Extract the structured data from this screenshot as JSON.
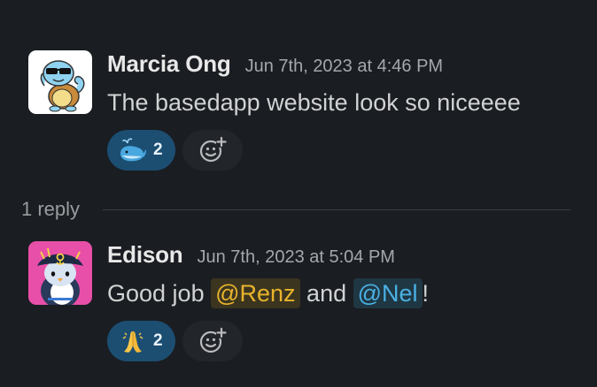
{
  "messages": [
    {
      "author": "Marcia Ong",
      "timestamp": "Jun 7th, 2023 at 4:46 PM",
      "text": "The basedapp website look so niceeee",
      "avatar_icon": "squirtle-sunglasses-icon",
      "reactions": [
        {
          "emoji_name": "whale-icon",
          "count": "2"
        }
      ]
    },
    {
      "author": "Edison",
      "timestamp": "Jun 7th, 2023 at 5:04 PM",
      "text_parts": {
        "before": "Good job ",
        "mention1": "@Renz",
        "middle": " and ",
        "mention2": "@Nel",
        "after": "!"
      },
      "avatar_icon": "pirate-penguin-icon",
      "reactions": [
        {
          "emoji_name": "folded-hands-icon",
          "count": "2"
        }
      ]
    }
  ],
  "thread": {
    "reply_label": "1 reply"
  },
  "colors": {
    "background": "#1a1d21",
    "reaction_active": "#1c4e72",
    "mention_yellow": "#e8b32c",
    "mention_blue": "#4ab1e4",
    "timestamp": "#a4a7ab"
  }
}
